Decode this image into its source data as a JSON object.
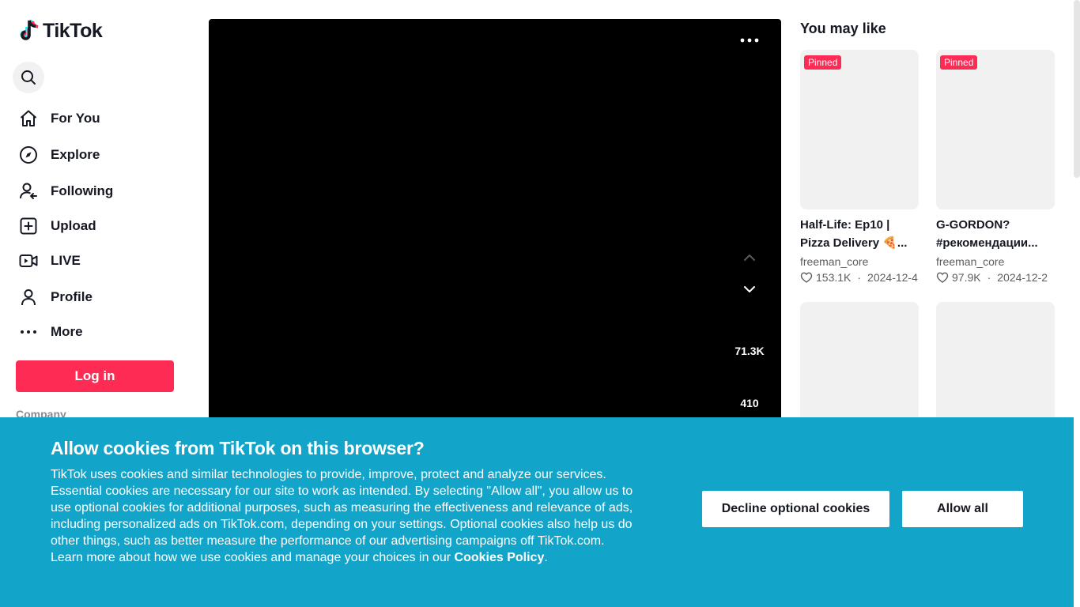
{
  "app": {
    "logo_text": "TikTok"
  },
  "sidebar": {
    "nav": [
      {
        "label": "For You",
        "icon": "home-icon"
      },
      {
        "label": "Explore",
        "icon": "compass-icon"
      },
      {
        "label": "Following",
        "icon": "following-icon"
      },
      {
        "label": "Upload",
        "icon": "upload-icon"
      },
      {
        "label": "LIVE",
        "icon": "live-icon"
      },
      {
        "label": "Profile",
        "icon": "profile-icon"
      },
      {
        "label": "More",
        "icon": "more-icon"
      }
    ],
    "login_label": "Log in",
    "company_label": "Company"
  },
  "video": {
    "likes": "71.3K",
    "comments": "410"
  },
  "you_may_like": {
    "title": "You may like",
    "cards": [
      {
        "badge": "Pinned",
        "title_line1": "Half-Life: Ep10 |",
        "title_line2": "Pizza Delivery 🍕...",
        "author": "freeman_core",
        "likes": "153.1K",
        "date": "2024-12-4"
      },
      {
        "badge": "Pinned",
        "title_line1": "G-GORDON?",
        "title_line2": "#рекомендации...",
        "author": "freeman_core",
        "likes": "97.9K",
        "date": "2024-12-2"
      }
    ]
  },
  "cookie_banner": {
    "title": "Allow cookies from TikTok on this browser?",
    "body": "TikTok uses cookies and similar technologies to provide, improve, protect and analyze our services. Essential cookies are necessary for our site to work as intended. By selecting \"Allow all\", you allow us to use optional cookies for additional purposes, such as measuring the effectiveness and relevance of ads, including personalized ads on TikTok.com, depending on your settings. Optional cookies also help us do other things, such as better measure the performance of our advertising campaigns off TikTok.com. Learn more about how we use cookies and manage your choices in our ",
    "policy_link": "Cookies Policy",
    "body_end": ".",
    "decline_label": "Decline optional cookies",
    "allow_label": "Allow all"
  },
  "colors": {
    "brand": "#fe2c55",
    "banner": "#12a4c9"
  }
}
